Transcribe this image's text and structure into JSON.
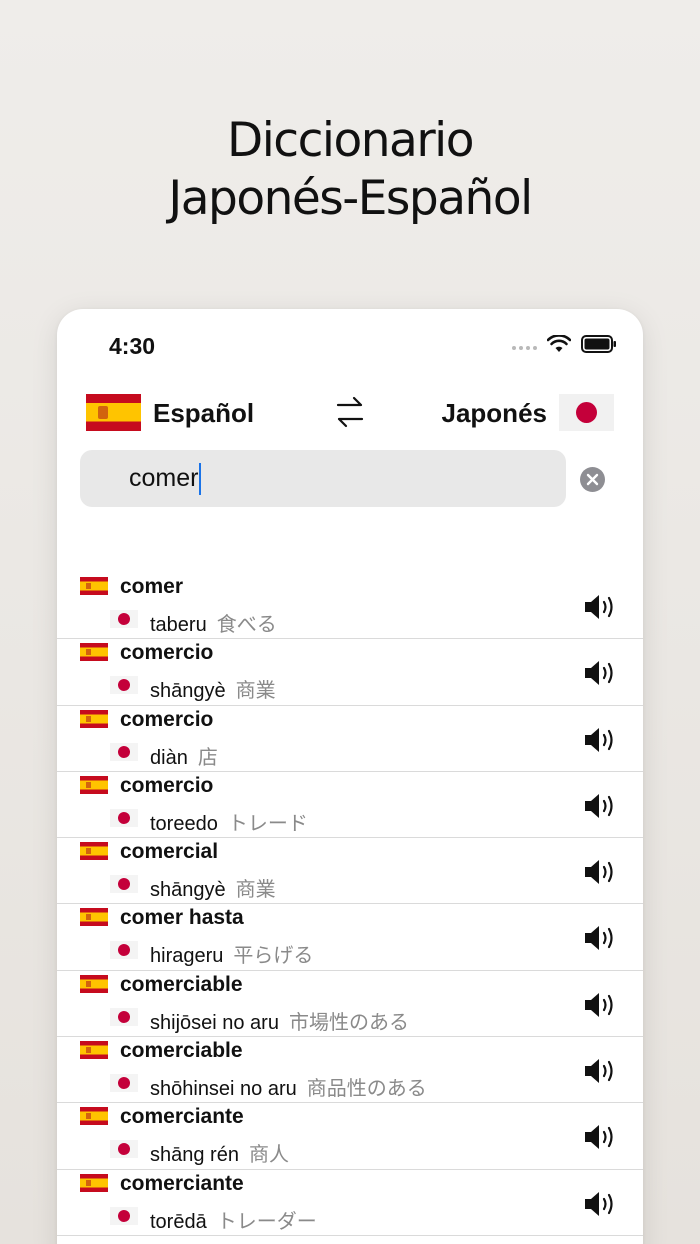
{
  "headline": {
    "line1": "Diccionario",
    "line2": "Japonés-Español"
  },
  "status": {
    "time": "4:30"
  },
  "languages": {
    "source": "Español",
    "target": "Japonés"
  },
  "search": {
    "value": "comer"
  },
  "results": [
    {
      "word": "comer",
      "translation": "taberu",
      "kana": "食べる"
    },
    {
      "word": "comercio",
      "translation": "shāngyè",
      "kana": "商業"
    },
    {
      "word": "comercio",
      "translation": "diàn",
      "kana": "店"
    },
    {
      "word": "comercio",
      "translation": "toreedo",
      "kana": "トレード"
    },
    {
      "word": "comercial",
      "translation": "shāngyè",
      "kana": "商業"
    },
    {
      "word": "comer hasta",
      "translation": "hirageru",
      "kana": "平らげる"
    },
    {
      "word": "comerciable",
      "translation": "shijōsei no aru",
      "kana": "市場性のある"
    },
    {
      "word": "comerciable",
      "translation": "shōhinsei no aru",
      "kana": "商品性のある"
    },
    {
      "word": "comerciante",
      "translation": "shāng rén",
      "kana": "商人"
    },
    {
      "word": "comerciante",
      "translation": "torēdā",
      "kana": "トレーダー"
    }
  ],
  "colors": {
    "accent": "#1a73e8",
    "spain_red": "#c60b1e",
    "spain_yellow": "#ffc400",
    "japan_red": "#c4003a"
  }
}
